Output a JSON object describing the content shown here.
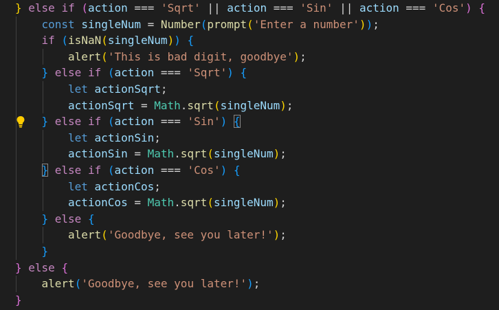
{
  "colors": {
    "background": "#1e1e1e",
    "keyword_control": "#c586c0",
    "keyword_storage": "#569cd6",
    "variable": "#9cdcfe",
    "function": "#dcdcaa",
    "string": "#ce9178",
    "class": "#4ec9b0",
    "bracket_level1": "#ffd700",
    "bracket_level2": "#da70d6",
    "bracket_level3": "#179fff",
    "lightbulb": "#ffcc00"
  },
  "icons": {
    "lightbulb": "lightbulb-icon"
  },
  "lines": [
    {
      "indent": 0,
      "tokens": [
        {
          "t": "}",
          "c": "b1"
        },
        {
          "t": " "
        },
        {
          "t": "else",
          "c": "kw"
        },
        {
          "t": " "
        },
        {
          "t": "if",
          "c": "kw"
        },
        {
          "t": " "
        },
        {
          "t": "(",
          "c": "b2"
        },
        {
          "t": "action",
          "c": "var"
        },
        {
          "t": " === "
        },
        {
          "t": "'Sqrt'",
          "c": "str"
        },
        {
          "t": " || "
        },
        {
          "t": "action",
          "c": "var"
        },
        {
          "t": " === "
        },
        {
          "t": "'Sin'",
          "c": "str"
        },
        {
          "t": " || "
        },
        {
          "t": "action",
          "c": "var"
        },
        {
          "t": " === "
        },
        {
          "t": "'Cos'",
          "c": "str"
        },
        {
          "t": ")",
          "c": "b2"
        },
        {
          "t": " "
        },
        {
          "t": "{",
          "c": "b2"
        }
      ]
    },
    {
      "indent": 1,
      "tokens": [
        {
          "t": "const",
          "c": "kw2"
        },
        {
          "t": " "
        },
        {
          "t": "singleNum",
          "c": "var"
        },
        {
          "t": " = "
        },
        {
          "t": "Number",
          "c": "fn"
        },
        {
          "t": "(",
          "c": "b3"
        },
        {
          "t": "prompt",
          "c": "fn"
        },
        {
          "t": "(",
          "c": "b1"
        },
        {
          "t": "'Enter a number'",
          "c": "str"
        },
        {
          "t": ")",
          "c": "b1"
        },
        {
          "t": ")",
          "c": "b3"
        },
        {
          "t": ";"
        }
      ]
    },
    {
      "indent": 1,
      "tokens": [
        {
          "t": "if",
          "c": "kw"
        },
        {
          "t": " "
        },
        {
          "t": "(",
          "c": "b3"
        },
        {
          "t": "isNaN",
          "c": "fn"
        },
        {
          "t": "(",
          "c": "b1"
        },
        {
          "t": "singleNum",
          "c": "var"
        },
        {
          "t": ")",
          "c": "b1"
        },
        {
          "t": ")",
          "c": "b3"
        },
        {
          "t": " "
        },
        {
          "t": "{",
          "c": "b3"
        }
      ]
    },
    {
      "indent": 2,
      "tokens": [
        {
          "t": "alert",
          "c": "fn"
        },
        {
          "t": "(",
          "c": "b1"
        },
        {
          "t": "'This is bad digit, goodbye'",
          "c": "str"
        },
        {
          "t": ")",
          "c": "b1"
        },
        {
          "t": ";"
        }
      ]
    },
    {
      "indent": 1,
      "tokens": [
        {
          "t": "}",
          "c": "b3"
        },
        {
          "t": " "
        },
        {
          "t": "else",
          "c": "kw"
        },
        {
          "t": " "
        },
        {
          "t": "if",
          "c": "kw"
        },
        {
          "t": " "
        },
        {
          "t": "(",
          "c": "b3"
        },
        {
          "t": "action",
          "c": "var"
        },
        {
          "t": " === "
        },
        {
          "t": "'Sqrt'",
          "c": "str"
        },
        {
          "t": ")",
          "c": "b3"
        },
        {
          "t": " "
        },
        {
          "t": "{",
          "c": "b3"
        }
      ]
    },
    {
      "indent": 2,
      "tokens": [
        {
          "t": "let",
          "c": "kw2"
        },
        {
          "t": " "
        },
        {
          "t": "actionSqrt",
          "c": "var"
        },
        {
          "t": ";"
        }
      ]
    },
    {
      "indent": 2,
      "tokens": [
        {
          "t": "actionSqrt",
          "c": "var"
        },
        {
          "t": " = "
        },
        {
          "t": "Math",
          "c": "cls"
        },
        {
          "t": "."
        },
        {
          "t": "sqrt",
          "c": "fn"
        },
        {
          "t": "(",
          "c": "b1"
        },
        {
          "t": "singleNum",
          "c": "var"
        },
        {
          "t": ")",
          "c": "b1"
        },
        {
          "t": ";"
        }
      ]
    },
    {
      "indent": 1,
      "bulb": true,
      "tokens": [
        {
          "t": "}",
          "c": "b3"
        },
        {
          "t": " "
        },
        {
          "t": "else",
          "c": "kw"
        },
        {
          "t": " "
        },
        {
          "t": "if",
          "c": "kw"
        },
        {
          "t": " "
        },
        {
          "t": "(",
          "c": "b3"
        },
        {
          "t": "action",
          "c": "var"
        },
        {
          "t": " === "
        },
        {
          "t": "'Sin'",
          "c": "str"
        },
        {
          "t": ")",
          "c": "b3"
        },
        {
          "t": " "
        },
        {
          "t": "{",
          "c": "b3",
          "m": true
        }
      ]
    },
    {
      "indent": 2,
      "tokens": [
        {
          "t": "let",
          "c": "kw2"
        },
        {
          "t": " "
        },
        {
          "t": "actionSin",
          "c": "var"
        },
        {
          "t": ";"
        }
      ]
    },
    {
      "indent": 2,
      "tokens": [
        {
          "t": "actionSin",
          "c": "var"
        },
        {
          "t": " = "
        },
        {
          "t": "Math",
          "c": "cls"
        },
        {
          "t": "."
        },
        {
          "t": "sqrt",
          "c": "fn"
        },
        {
          "t": "(",
          "c": "b1"
        },
        {
          "t": "singleNum",
          "c": "var"
        },
        {
          "t": ")",
          "c": "b1"
        },
        {
          "t": ";"
        }
      ]
    },
    {
      "indent": 1,
      "tokens": [
        {
          "t": "}",
          "c": "b3",
          "m": true
        },
        {
          "t": " "
        },
        {
          "t": "else",
          "c": "kw"
        },
        {
          "t": " "
        },
        {
          "t": "if",
          "c": "kw"
        },
        {
          "t": " "
        },
        {
          "t": "(",
          "c": "b3"
        },
        {
          "t": "action",
          "c": "var"
        },
        {
          "t": " === "
        },
        {
          "t": "'Cos'",
          "c": "str"
        },
        {
          "t": ")",
          "c": "b3"
        },
        {
          "t": " "
        },
        {
          "t": "{",
          "c": "b3"
        }
      ]
    },
    {
      "indent": 2,
      "tokens": [
        {
          "t": "let",
          "c": "kw2"
        },
        {
          "t": " "
        },
        {
          "t": "actionCos",
          "c": "var"
        },
        {
          "t": ";"
        }
      ]
    },
    {
      "indent": 2,
      "tokens": [
        {
          "t": "actionCos",
          "c": "var"
        },
        {
          "t": " = "
        },
        {
          "t": "Math",
          "c": "cls"
        },
        {
          "t": "."
        },
        {
          "t": "sqrt",
          "c": "fn"
        },
        {
          "t": "(",
          "c": "b1"
        },
        {
          "t": "singleNum",
          "c": "var"
        },
        {
          "t": ")",
          "c": "b1"
        },
        {
          "t": ";"
        }
      ]
    },
    {
      "indent": 1,
      "tokens": [
        {
          "t": "}",
          "c": "b3"
        },
        {
          "t": " "
        },
        {
          "t": "else",
          "c": "kw"
        },
        {
          "t": " "
        },
        {
          "t": "{",
          "c": "b3"
        }
      ]
    },
    {
      "indent": 2,
      "tokens": [
        {
          "t": "alert",
          "c": "fn"
        },
        {
          "t": "(",
          "c": "b1"
        },
        {
          "t": "'Goodbye, see you later!'",
          "c": "str"
        },
        {
          "t": ")",
          "c": "b1"
        },
        {
          "t": ";"
        }
      ]
    },
    {
      "indent": 1,
      "tokens": [
        {
          "t": "}",
          "c": "b3"
        }
      ]
    },
    {
      "indent": 0,
      "tokens": [
        {
          "t": "}",
          "c": "b2"
        },
        {
          "t": " "
        },
        {
          "t": "else",
          "c": "kw"
        },
        {
          "t": " "
        },
        {
          "t": "{",
          "c": "b2"
        }
      ]
    },
    {
      "indent": 1,
      "tokens": [
        {
          "t": "alert",
          "c": "fn"
        },
        {
          "t": "(",
          "c": "b3"
        },
        {
          "t": "'Goodbye, see you later!'",
          "c": "str"
        },
        {
          "t": ")",
          "c": "b3"
        },
        {
          "t": ";"
        }
      ]
    },
    {
      "indent": 0,
      "tokens": [
        {
          "t": "}",
          "c": "b2"
        }
      ]
    }
  ]
}
